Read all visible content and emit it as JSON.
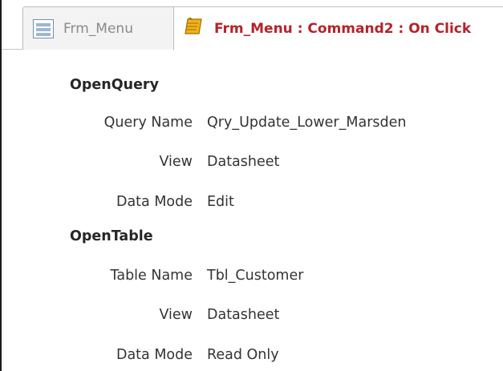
{
  "tabs": [
    {
      "label": "Frm_Menu",
      "icon": "form-icon",
      "active": false
    },
    {
      "label": "Frm_Menu : Command2 : On Click",
      "icon": "macro-scroll-icon",
      "active": true
    }
  ],
  "macro": {
    "actions": [
      {
        "name": "OpenQuery",
        "arguments": [
          {
            "label": "Query Name",
            "value": "Qry_Update_Lower_Marsden"
          },
          {
            "label": "View",
            "value": "Datasheet"
          },
          {
            "label": "Data Mode",
            "value": "Edit"
          }
        ]
      },
      {
        "name": "OpenTable",
        "arguments": [
          {
            "label": "Table Name",
            "value": "Tbl_Customer"
          },
          {
            "label": "View",
            "value": "Datasheet"
          },
          {
            "label": "Data Mode",
            "value": "Read Only"
          }
        ]
      }
    ]
  },
  "colors": {
    "active_tab_text": "#b4232a",
    "inactive_tab_text": "#8a8a8a",
    "macro_icon_gold": "#f2b21b"
  }
}
